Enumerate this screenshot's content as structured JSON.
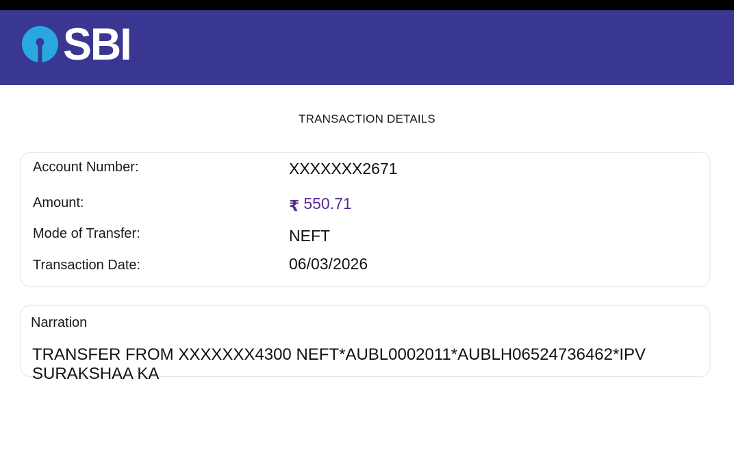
{
  "header": {
    "brand_text": "SBI",
    "brand_color": "#3a3793",
    "logo_icon": "sbi-keyhole-logo"
  },
  "page": {
    "title": "TRANSACTION DETAILS"
  },
  "details": {
    "account_number_label": "Account Number:",
    "account_number_value": "XXXXXXX2671",
    "amount_label": "Amount:",
    "amount_currency_symbol": "₹",
    "amount_value": "550.71",
    "amount_color": "#5a2d91",
    "mode_label": "Mode of Transfer:",
    "mode_value": "NEFT",
    "date_label": "Transaction Date:",
    "date_value": "06/03/2026"
  },
  "narration": {
    "label": "Narration",
    "text": "TRANSFER FROM XXXXXXX4300 NEFT*AUBL0002011*AUBLH06524736462*IPV SURAKSHAA KA"
  }
}
